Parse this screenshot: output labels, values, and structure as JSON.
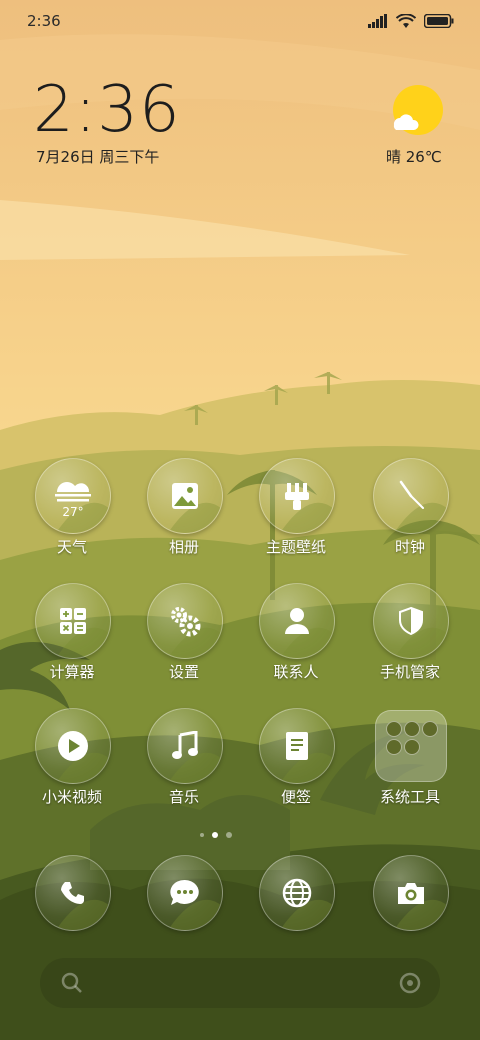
{
  "status_bar": {
    "time": "2:36",
    "icons": [
      "signal-icon",
      "wifi-icon",
      "battery-icon"
    ]
  },
  "clock_widget": {
    "time": "2:36",
    "date": "7月26日 周三下午"
  },
  "weather_widget": {
    "icon": "sun-cloud-icon",
    "text": "晴 26℃"
  },
  "apps": [
    {
      "label": "天气",
      "icon": "weather-icon",
      "extra": "27°"
    },
    {
      "label": "相册",
      "icon": "gallery-icon"
    },
    {
      "label": "主题壁纸",
      "icon": "brush-icon"
    },
    {
      "label": "时钟",
      "icon": "clock-icon"
    },
    {
      "label": "计算器",
      "icon": "calculator-icon"
    },
    {
      "label": "设置",
      "icon": "gear-icon"
    },
    {
      "label": "联系人",
      "icon": "person-icon"
    },
    {
      "label": "手机管家",
      "icon": "shield-icon"
    },
    {
      "label": "小米视频",
      "icon": "play-icon"
    },
    {
      "label": "音乐",
      "icon": "music-note-icon"
    },
    {
      "label": "便签",
      "icon": "note-icon"
    },
    {
      "label": "系统工具",
      "icon": "folder-icon"
    }
  ],
  "dock": [
    {
      "icon": "phone-icon"
    },
    {
      "icon": "message-icon"
    },
    {
      "icon": "browser-icon"
    },
    {
      "icon": "camera-icon"
    }
  ],
  "page_indicator": {
    "count": 3,
    "active": 1
  },
  "colors": {
    "sky_top": "#f0c684",
    "sky_bottom": "#f8dc8f",
    "hill_far": "#b6b75a",
    "hill_mid": "#8c9a3e",
    "foreground": "#3f4d1d",
    "sun": "#ffd21a"
  }
}
